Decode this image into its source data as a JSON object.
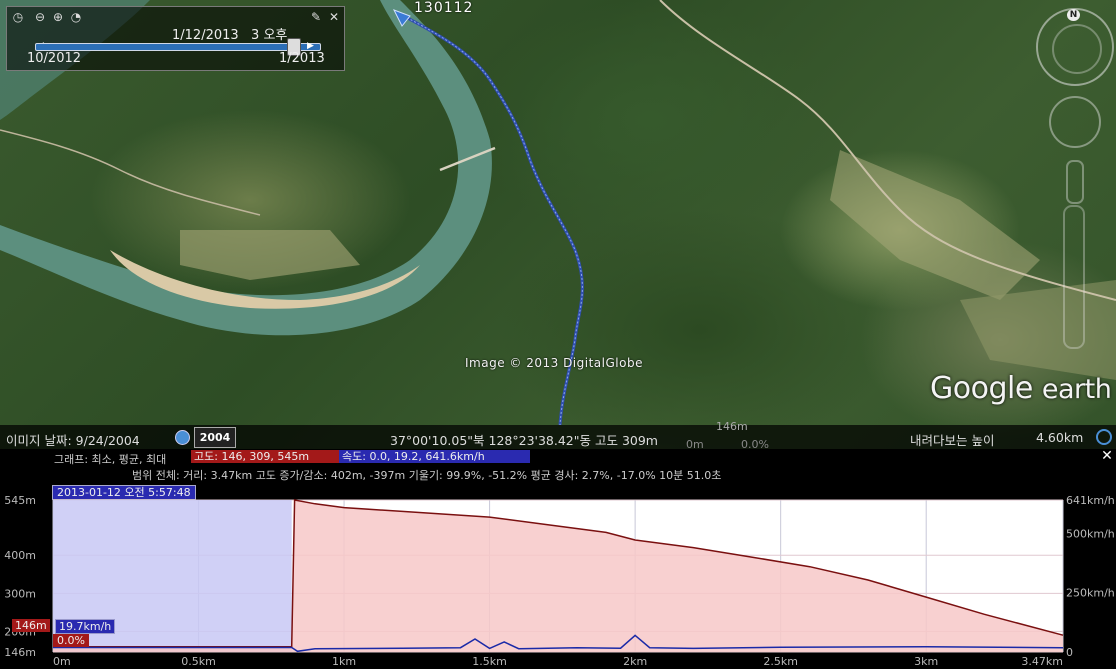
{
  "time_slider": {
    "current_time": "1/12/2013   3 오후",
    "start_label": "10/2012",
    "end_label": "1/2013"
  },
  "map": {
    "track_label": "130112",
    "copyright": "Image © 2013 DigitalGlobe",
    "logo_google": "Google",
    "logo_earth": "earth",
    "compass_letter": "N"
  },
  "status_bar": {
    "imagery_date": "이미지 날짜: 9/24/2004",
    "year_badge": "2004",
    "coordinates": "37°00'10.05\"북 128°23'38.42\"동 고도   309m",
    "eye_altitude_label": "내려다보는 높이",
    "eye_altitude_value": "4.60km",
    "ghost_146": "146m",
    "ghost_0m": "0m",
    "ghost_pct": "0.0%"
  },
  "profile": {
    "graph_label": "그래프: 최소, 평균, 최대",
    "altitude_stats": "고도: 146, 309, 545m",
    "speed_stats": "속도: 0.0, 19.2, 641.6km/h",
    "range_stats": "범위 전체: 거리: 3.47km 고도 증가/감소: 402m, -397m 기울기: 99.9%, -51.2% 평균 경사: 2.7%, -17.0% 10분 51.0초",
    "timestamp": "2013-01-12 오전 5:57:48",
    "cursor_altitude": "146m",
    "cursor_speed": "19.7km/h",
    "cursor_grade": "0.0%",
    "close_icon": "close-icon"
  },
  "chart_data": {
    "type": "line",
    "title": "",
    "x_unit": "km",
    "x_ticks": [
      "0m",
      "0.5km",
      "1km",
      "1.5km",
      "2km",
      "2.5km",
      "3km",
      "3.47km"
    ],
    "x_tick_values": [
      0,
      0.5,
      1.0,
      1.5,
      2.0,
      2.5,
      3.0,
      3.47
    ],
    "xlim": [
      0,
      3.47
    ],
    "y_left_ticks": [
      "545m",
      "400m",
      "300m",
      "200m",
      "146m"
    ],
    "y_left_tick_values": [
      545,
      400,
      300,
      200,
      146
    ],
    "ylim_left": [
      146,
      545
    ],
    "y_right_ticks": [
      "641km/h",
      "500km/h",
      "250km/h",
      "0"
    ],
    "y_right_tick_values": [
      641,
      500,
      250,
      0
    ],
    "ylim_right": [
      0,
      641
    ],
    "selection_range_km": [
      0,
      0.82
    ],
    "series": [
      {
        "name": "고도",
        "axis": "left",
        "color": "#7a1010",
        "fill": "#f7c8c8",
        "x": [
          0,
          0.82,
          0.83,
          0.9,
          1.0,
          1.2,
          1.5,
          1.7,
          1.9,
          2.0,
          2.2,
          2.4,
          2.6,
          2.8,
          3.0,
          3.2,
          3.47
        ],
        "y": [
          160,
          160,
          545,
          535,
          525,
          515,
          500,
          480,
          460,
          440,
          420,
          395,
          370,
          335,
          290,
          245,
          190
        ]
      },
      {
        "name": "속도",
        "axis": "right",
        "color": "#1a2aa8",
        "x": [
          0,
          0.82,
          0.84,
          0.9,
          1.2,
          1.4,
          1.45,
          1.5,
          1.55,
          1.6,
          1.8,
          1.95,
          2.0,
          2.05,
          2.2,
          2.5,
          3.0,
          3.47
        ],
        "y": [
          19,
          19,
          3,
          14,
          16,
          18,
          55,
          15,
          42,
          14,
          18,
          16,
          70,
          18,
          15,
          20,
          22,
          18
        ]
      }
    ]
  }
}
